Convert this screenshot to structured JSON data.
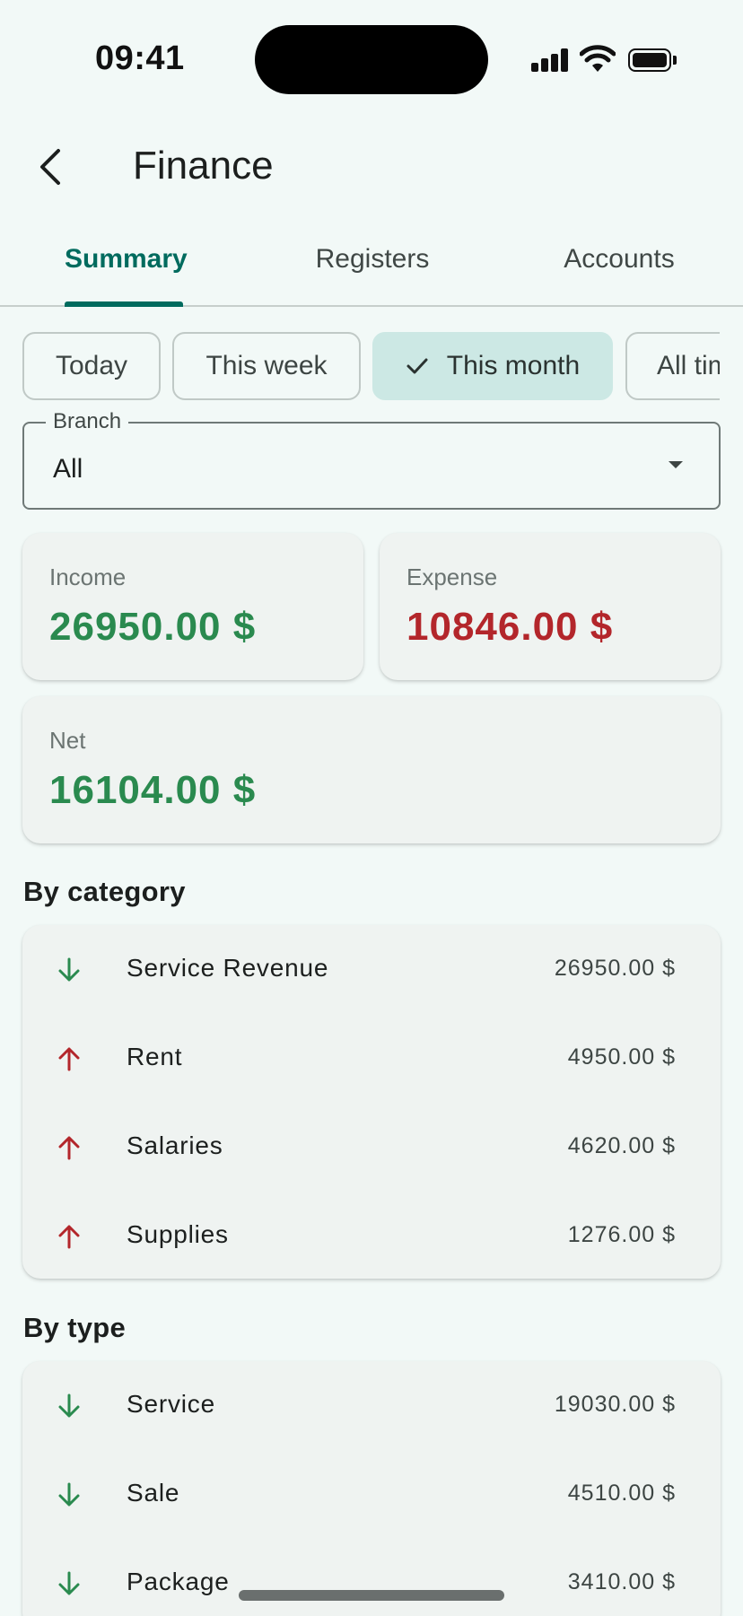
{
  "status_bar": {
    "time": "09:41"
  },
  "header": {
    "title": "Finance"
  },
  "tabs": [
    {
      "label": "Summary",
      "active": true
    },
    {
      "label": "Registers",
      "active": false
    },
    {
      "label": "Accounts",
      "active": false
    }
  ],
  "period_chips": [
    {
      "label": "Today",
      "selected": false
    },
    {
      "label": "This week",
      "selected": false
    },
    {
      "label": "This month",
      "selected": true
    },
    {
      "label": "All time",
      "selected": false
    }
  ],
  "branch": {
    "label": "Branch",
    "value": "All"
  },
  "summary": {
    "income": {
      "label": "Income",
      "value": "26950.00 $"
    },
    "expense": {
      "label": "Expense",
      "value": "10846.00 $"
    },
    "net": {
      "label": "Net",
      "value": "16104.00 $"
    }
  },
  "by_category": {
    "title": "By category",
    "items": [
      {
        "label": "Service Revenue",
        "amount": "26950.00 $",
        "direction": "income",
        "icon": "arrow-down-icon"
      },
      {
        "label": "Rent",
        "amount": "4950.00 $",
        "direction": "expense",
        "icon": "arrow-up-icon"
      },
      {
        "label": "Salaries",
        "amount": "4620.00 $",
        "direction": "expense",
        "icon": "arrow-up-icon"
      },
      {
        "label": "Supplies",
        "amount": "1276.00 $",
        "direction": "expense",
        "icon": "arrow-up-icon"
      }
    ]
  },
  "by_type": {
    "title": "By type",
    "items": [
      {
        "label": "Service",
        "amount": "19030.00 $",
        "direction": "income",
        "icon": "arrow-down-icon"
      },
      {
        "label": "Sale",
        "amount": "4510.00 $",
        "direction": "income",
        "icon": "arrow-down-icon"
      },
      {
        "label": "Package",
        "amount": "3410.00 $",
        "direction": "income",
        "icon": "arrow-down-icon"
      }
    ]
  },
  "colors": {
    "accent": "#006b5e",
    "income": "#2a8a4f",
    "expense": "#b3262b",
    "selected_chip": "#cce8e4",
    "background": "#f2f9f7"
  }
}
